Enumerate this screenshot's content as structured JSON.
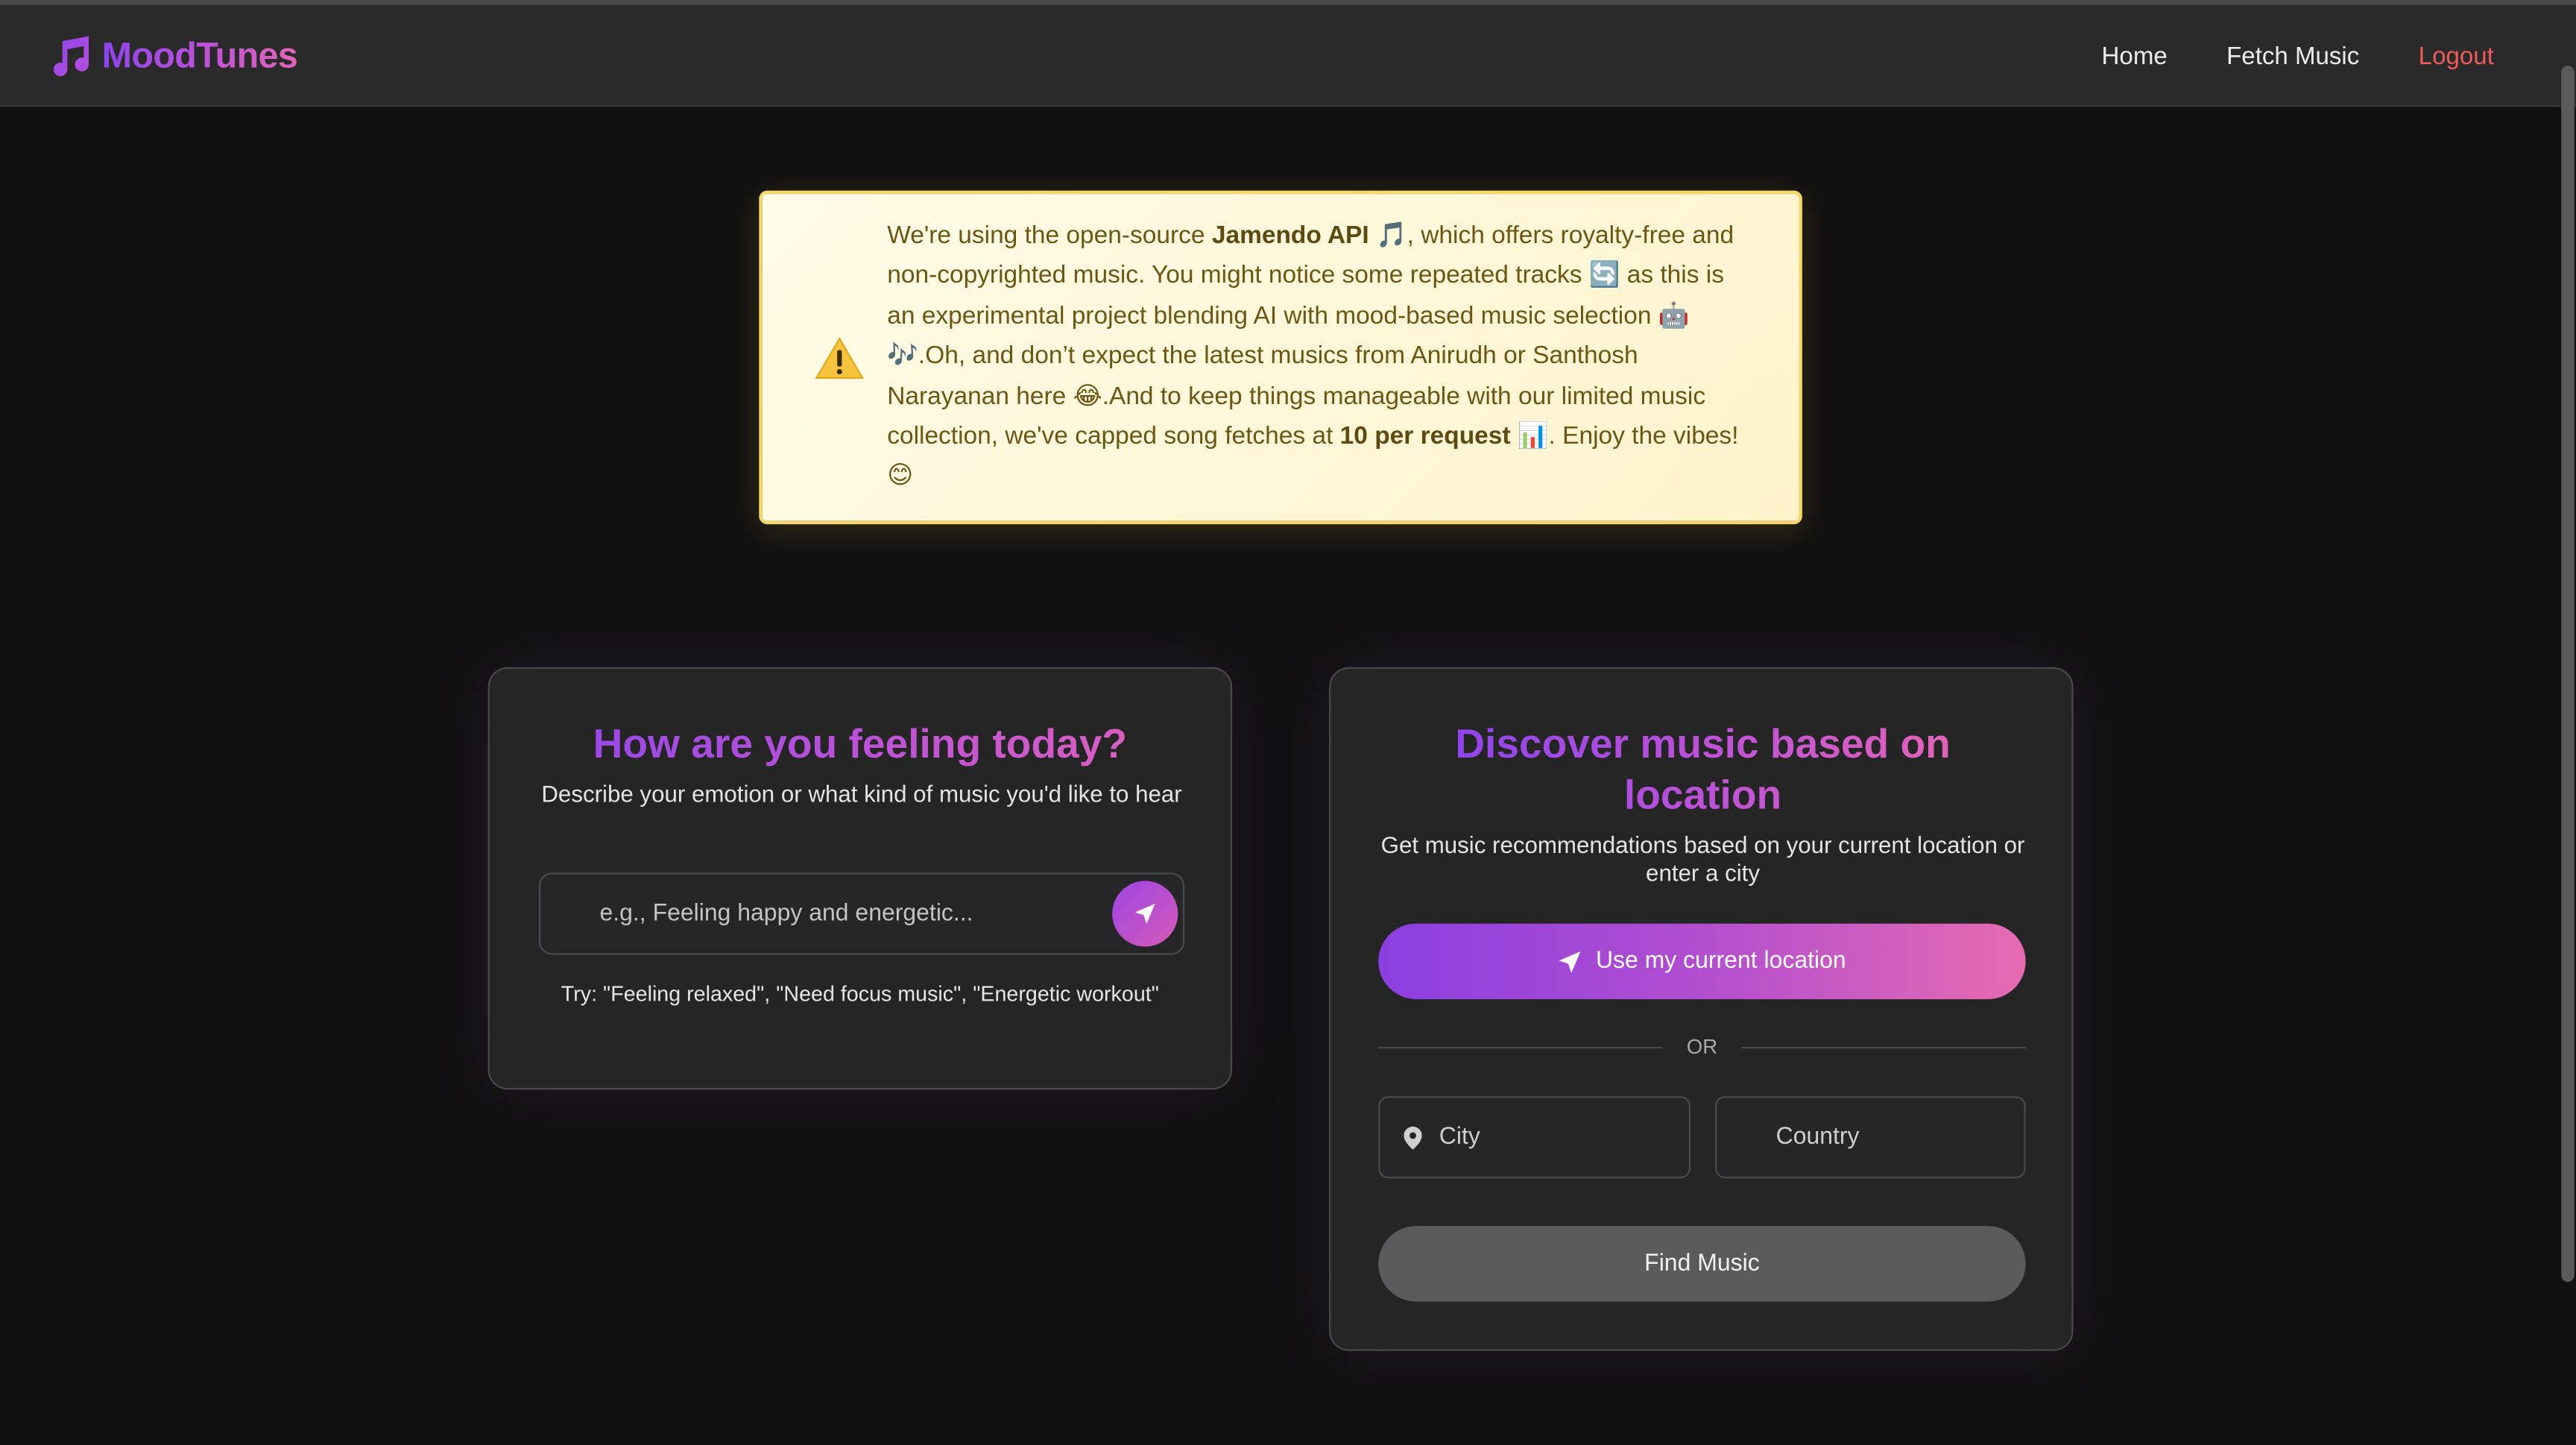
{
  "navbar": {
    "brand": "MoodTunes",
    "links": [
      "Home",
      "Fetch Music",
      "Logout"
    ]
  },
  "notice": {
    "s1": "We're using the open-source ",
    "b1": "Jamendo API",
    "s2": " 🎵, which offers royalty-free and non-copyrighted music. You might notice some repeated tracks 🔄 as this is an experimental project blending AI with mood-based music selection 🤖🎶.Oh, and don’t expect the latest musics from Anirudh or Santhosh Narayanan here 😂.And to keep things manageable with our limited music collection, we've capped song fetches at ",
    "b2": "10 per request",
    "s3": " 📊. Enjoy the vibes! 😊"
  },
  "mood_card": {
    "title": "How are you feeling today?",
    "subtitle": "Describe your emotion or what kind of music you'd like to hear",
    "placeholder": "e.g., Feeling happy and energetic...",
    "try_text": "Try: \"Feeling relaxed\", \"Need focus music\", \"Energetic workout\""
  },
  "location_card": {
    "title": "Discover music based on location",
    "subtitle": "Get music recommendations based on your current location or enter a city",
    "location_button": "Use my current location",
    "or_text": "OR",
    "city_placeholder": "City",
    "country_placeholder": "Country",
    "find_button": "Find Music"
  },
  "colors": {
    "accent_start": "#8e44ec",
    "accent_end": "#e363b6",
    "logout": "#ef5a5a",
    "background": "#121112"
  },
  "icons": [
    "music-note-icon",
    "warning-icon",
    "send-icon",
    "navigation-arrow-icon",
    "map-pin-icon"
  ]
}
